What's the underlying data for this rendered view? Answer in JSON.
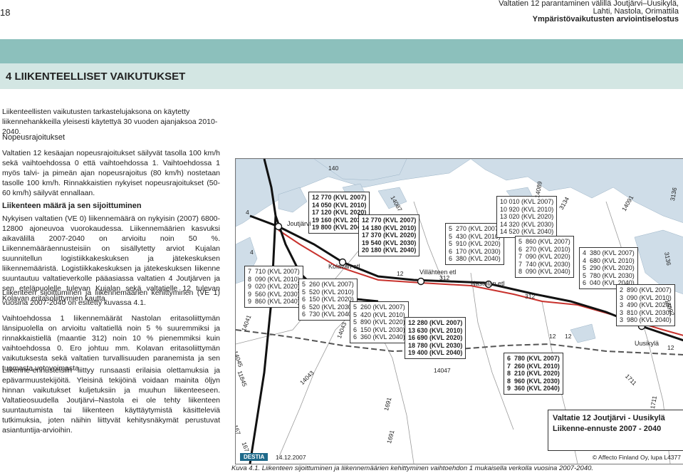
{
  "header": {
    "page_number": "18",
    "title_line1": "Valtatien 12 parantaminen välillä Joutjärvi–Uusikylä,",
    "title_line2": "Lahti, Nastola, Orimattila",
    "title_line3": "Ympäristövaikutusten arviointiselostus"
  },
  "section": {
    "title": "4   LIIKENTEELLISET VAIKUTUKSET"
  },
  "body": {
    "intro": "Liikenteellisten vaikutusten tarkastelujaksona on käytetty liikennehank­keilla yleisesti käytettyä 30 vuoden ajanjaksoa 2010-2040.",
    "h_speed": "Nopeusrajoitukset",
    "p_speed": "Valtatien 12 kesäajan nopeusrajoitukset säilyvät tasolla 100 km/h sekä vaihtoehdossa 0 että vaihtoehdossa 1. Vaihtoehdossa 1 myös talvi- ja pimeän ajan nopeusrajoitus (80 km/h) nostetaan tasolle 100 km/h. Rinnakkaistien nykyiset nopeusrajoitukset (50-60 km/h) säilyvät ennallaan.",
    "h_traffic": "Liikenteen määrä ja sen sijoittuminen",
    "p_traffic1": "Nykyisen valtatien (VE 0) liikennemäärä on nykyisin (2007) 6800-12800 ajoneuvoa vuorokaudessa. Liikennemäärien kasvuksi aikavälillä 2007-2040 on arvioitu noin 50 %. Liikennemääräennusteisiin on sisällytetty arviot Kujalan suunnitellun logistiikkakeskuksen ja jätekeskuksen liikennemääristä. Logistiikkakeskuksen ja jätekeskuksen liikenne suuntautuu valtatieverkolle pääasiassa valtatien 4 Joutjärven ja sen eteläpuolelle tulevan Kujalan sekä valtatielle 12 tulevan Kolavan eritasoliittymien kautta.",
    "p_traffic2": "Liikenteen sijoittuminen ja liikennemäärien kehittyminen (VE 1) vuosina 2007-2040 on esitetty kuvassa 4.1.",
    "p_traffic3": "Vaihtoehdossa 1 liikennemäärät Nastolan eritasoliittymän länsipuolella on arvioitu valtatiellä noin 5 % suuremmiksi ja rinnakkaistiellä (maantie 312) noin 10 % pienemmiksi kuin vaihtoehdossa 0. Ero johtuu mm. Kolavan eritasoliittymän vaikutuksesta sekä valtatien turvallisuuden paranemista ja sen tuomasta vetovoimasta.",
    "p_traffic4": "Liikenne-ennusteisiin liittyy runsaasti erilaisia olettamuksia ja epävar­muustekijöitä. Yleisinä tekijöinä voidaan mainita öljyn hinnan vaikutukset kuljetuksiin ja muuhun liikenteeseen. Valtatieosuudella Joutjärvi–Nas­tola ei ole tehty liikenteen suuntautumista tai liikenteen käyttäytymistä käsitteleviä tutkimuksia, joten näihin liittyvät kehitysnäkymät perustuvat asiantuntija-arvioihin."
  },
  "map": {
    "boxes": {
      "b1": "12 770 (KVL 2007)\n14 050 (KVL 2010)\n17 120 (KVL 2020)\n19 160 (KVL 2030)\n19 800 (KVL 2040)",
      "b2": "7  710 (KVL 2007)\n8  090 (KVL 2010)\n9  020 (KVL 2020)\n9  560 (KVL 2030)\n9  860 (KVL 2040)",
      "b3": "5  260 (KVL 2007)\n5  520 (KVL 2010)\n6  150 (KVL 2020)\n6  520 (KVL 2030)\n6  730 (KVL 2040)",
      "b4": "12 770 (KVL 2007)\n14 180 (KVL 2010)\n17 370 (KVL 2020)\n19 540 (KVL 2030)\n20 180 (KVL 2040)",
      "b5": "5  270 (KVL 2007)\n5  430 (KVL 2010)\n5  910 (KVL 2020)\n6  170 (KVL 2030)\n6  380 (KVL 2040)",
      "b6": "5  260 (KVL 2007)\n5  420 (KVL 2010)\n5  890 (KVL 2020)\n6  150 (KVL 2030)\n6  360 (KVL 2040)",
      "b7": "12 280 (KVL 2007)\n13 630 (KVL 2010)\n16 690 (KVL 2020)\n18 780 (KVL 2030)\n19 400 (KVL 2040)",
      "b8": "10 010 (KVL 2007)\n10 920 (KVL 2010)\n13 020 (KVL 2020)\n14 320 (KVL 2030)\n14 520 (KVL 2040)",
      "b9": "5  860 (KVL 2007)\n6  270 (KVL 2010)\n7  090 (KVL 2020)\n7  740 (KVL 2030)\n8  090 (KVL 2040)",
      "b10": "4  380 (KVL 2007)\n4  680 (KVL 2010)\n5  290 (KVL 2020)\n5  780 (KVL 2030)\n6  040 (KVL 2040)",
      "b11": "2  890 (KVL 2007)\n3  090 (KVL 2010)\n3  490 (KVL 2020)\n3  810 (KVL 2030)\n3  980 (KVL 2040)",
      "b12": "6  780 (KVL 2007)\n7  260 (KVL 2010)\n8  210 (KVL 2020)\n8  960 (KVL 2030)\n9  360 (KVL 2040)"
    },
    "places": {
      "joutjarvi": "Joutjärvi",
      "kolava": "Kolavan etl",
      "villahde": "Villähteen etl",
      "nastola": "Nastolan etl",
      "uusikyla": "Uusikylä"
    },
    "roads": {
      "r4a": "4",
      "r4b": "4",
      "r12a": "12",
      "r12b": "12",
      "r12c": "12",
      "r12d": "12",
      "r312a": "312",
      "r312b": "312",
      "r140": "140",
      "r14041": "14041",
      "r14045": "14045",
      "r11845": "11845",
      "r14043a": "14043",
      "r14043b": "14043",
      "r14087": "14087",
      "r14047": "14047",
      "r1691a": "1691",
      "r1691b": "1691",
      "r14089": "14089",
      "r3134": "3134",
      "r14091": "14091",
      "r3136a": "3136",
      "r3136b": "3136",
      "r14092": "14092",
      "r1711a": "1711",
      "r1711b": "1711",
      "r167": "167",
      "r1671": "167"
    },
    "legend_line1": "Valtatie 12 Joutjärvi - Uusikylä",
    "legend_line2": "Liikenne-ennuste 2007 - 2040",
    "destia": "DESTIA",
    "date": "14.12.2007",
    "copyright": "© Affecto Finland Oy, lupa L4377"
  },
  "caption": "Kuva 4.1. Liikenteen sijoittuminen ja liikennemäärien kehittyminen vaihtoehdon 1 mukaisella verkolla vuosina 2007-2040.",
  "colors": {
    "teal_band": "#8cc0bc",
    "title_bar": "#d3e6e3",
    "lake": "#cfdde8",
    "road_red": "#c8322d",
    "road_main": "#111111"
  }
}
